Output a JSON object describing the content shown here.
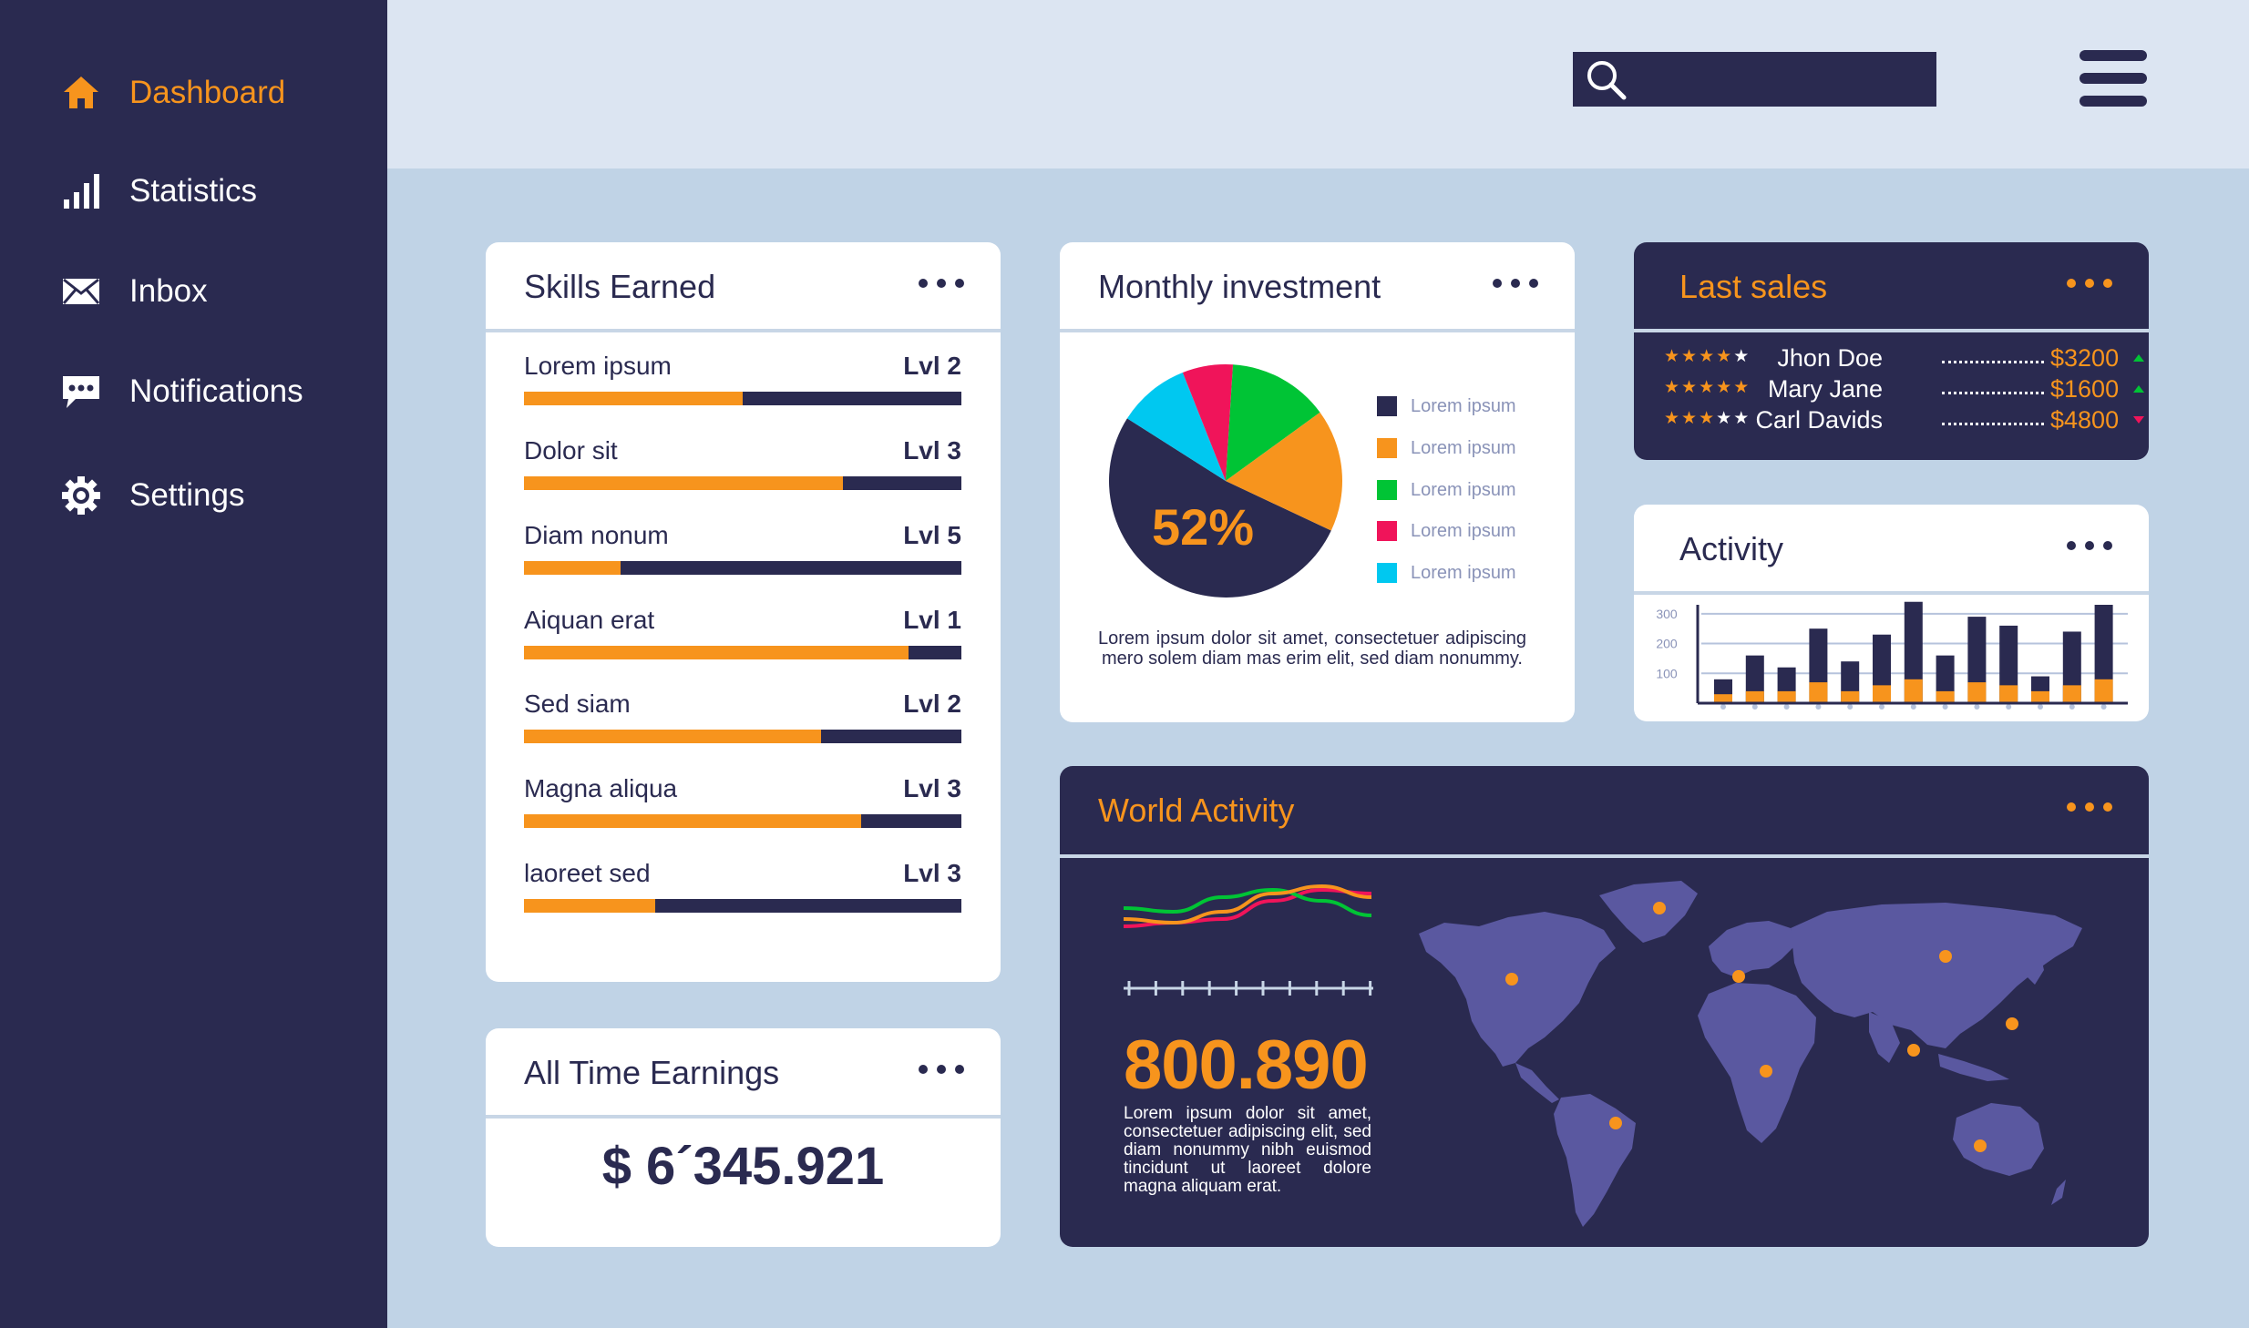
{
  "sidebar": {
    "items": [
      {
        "label": "Dashboard",
        "icon": "home-icon",
        "active": true
      },
      {
        "label": "Statistics",
        "icon": "bar-chart-icon",
        "active": false
      },
      {
        "label": "Inbox",
        "icon": "envelope-icon",
        "active": false
      },
      {
        "label": "Notifications",
        "icon": "chat-bubble-icon",
        "active": false
      },
      {
        "label": "Settings",
        "icon": "gear-icon",
        "active": false
      }
    ]
  },
  "topbar": {
    "search_value": "",
    "search_icon": "search-icon",
    "menu_icon": "hamburger-menu-icon"
  },
  "skills": {
    "title": "Skills Earned",
    "items": [
      {
        "name": "Lorem ipsum",
        "level": "Lvl 2",
        "progress": 0.5
      },
      {
        "name": "Dolor sit",
        "level": "Lvl 3",
        "progress": 0.73
      },
      {
        "name": "Diam nonum",
        "level": "Lvl 5",
        "progress": 0.22
      },
      {
        "name": "Aiquan erat",
        "level": "Lvl 1",
        "progress": 0.88
      },
      {
        "name": "Sed siam",
        "level": "Lvl 2",
        "progress": 0.68
      },
      {
        "name": "Magna aliqua",
        "level": "Lvl 3",
        "progress": 0.77
      },
      {
        "name": "laoreet sed",
        "level": "Lvl 3",
        "progress": 0.3
      }
    ]
  },
  "earnings": {
    "title": "All Time Earnings",
    "value": "$ 6´345.921"
  },
  "investment": {
    "title": "Monthly investment",
    "center_label": "52%",
    "description": "Lorem ipsum dolor sit amet, consectetuer adipiscing mero solem diam mas erim elit, sed diam nonummy.",
    "legend": [
      {
        "label": "Lorem ipsum",
        "color": "#2a2a50"
      },
      {
        "label": "Lorem ipsum",
        "color": "#f7941d"
      },
      {
        "label": "Lorem ipsum",
        "color": "#00c435"
      },
      {
        "label": "Lorem ipsum",
        "color": "#f0145a"
      },
      {
        "label": "Lorem ipsum",
        "color": "#00c8f0"
      }
    ]
  },
  "chart_data": [
    {
      "type": "pie",
      "title": "Monthly investment",
      "categories": [
        "Lorem ipsum",
        "Lorem ipsum",
        "Lorem ipsum",
        "Lorem ipsum",
        "Lorem ipsum"
      ],
      "values": [
        52,
        17,
        14,
        7,
        10
      ],
      "colors": [
        "#2a2a50",
        "#f7941d",
        "#00c435",
        "#f0145a",
        "#00c8f0"
      ]
    },
    {
      "type": "bar",
      "title": "Activity",
      "yticks": [
        "100",
        "200",
        "300"
      ],
      "ylim": [
        0,
        330
      ],
      "series": [
        {
          "values": [
            80,
            160,
            120,
            250,
            140,
            230,
            340,
            160,
            290,
            260,
            90,
            240,
            330
          ]
        },
        {
          "values": [
            30,
            40,
            40,
            70,
            40,
            60,
            80,
            40,
            70,
            60,
            40,
            60,
            80
          ]
        }
      ],
      "colors": [
        "#2a2a50",
        "#f7941d"
      ]
    },
    {
      "type": "line",
      "series": [
        {
          "values": [
            0.55,
            0.5,
            0.45,
            0.2,
            0.05,
            0.1
          ],
          "color": "#f0145a"
        },
        {
          "values": [
            0.3,
            0.35,
            0.15,
            0.05,
            0.2,
            0.4
          ],
          "color": "#00c435"
        },
        {
          "values": [
            0.45,
            0.5,
            0.35,
            0.1,
            0.0,
            0.15
          ],
          "color": "#f7941d"
        }
      ]
    }
  ],
  "last_sales": {
    "title": "Last sales",
    "rows": [
      {
        "stars": 4,
        "name": "Jhon Doe",
        "amount": "$3200",
        "trend": "up"
      },
      {
        "stars": 5,
        "name": "Mary Jane",
        "amount": "$1600",
        "trend": "up"
      },
      {
        "stars": 3,
        "name": "Carl Davids",
        "amount": "$4800",
        "trend": "down"
      }
    ],
    "trend_colors": {
      "up": "#00c435",
      "down": "#f0145a"
    }
  },
  "activity": {
    "title": "Activity"
  },
  "world": {
    "title": "World Activity",
    "value": "800.890",
    "description": "Lorem ipsum dolor sit amet, consectetuer adipiscing elit, sed diam nonummy nibh euismod tincidunt ut laoreet dolore magna aliquam erat."
  },
  "colors": {
    "navy": "#2a2a50",
    "orange": "#f7941d",
    "background": "#c0d3e6",
    "topbar": "#dce5f2",
    "map_land": "#5a58a0"
  }
}
